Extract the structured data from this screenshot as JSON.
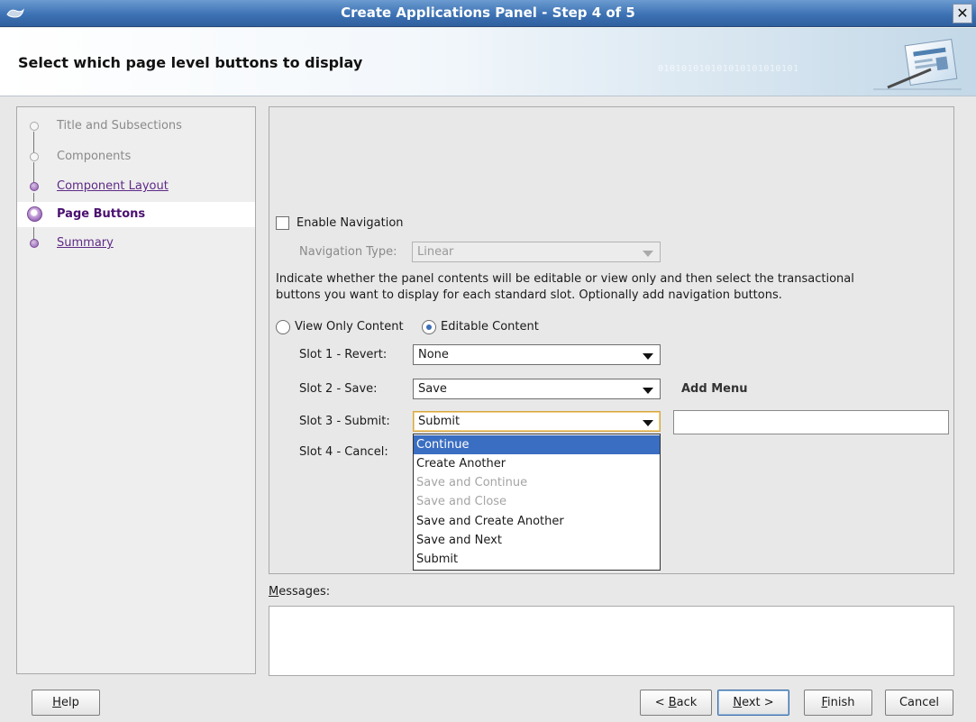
{
  "window": {
    "title": "Create Applications Panel - Step 4 of 5",
    "close_glyph": "✕"
  },
  "header": {
    "heading": "Select which page level buttons to display",
    "decoration_text": "010101010101010101010101"
  },
  "steps": [
    {
      "label": "Title and Subsections",
      "state": "completed"
    },
    {
      "label": "Components",
      "state": "completed"
    },
    {
      "label": "Component Layout",
      "state": "link"
    },
    {
      "label": "Page Buttons",
      "state": "current"
    },
    {
      "label": "Summary",
      "state": "link"
    }
  ],
  "form": {
    "enable_navigation_label": "Enable Navigation",
    "enable_navigation_checked": false,
    "navigation_type_label": "Navigation Type:",
    "navigation_type_value": "Linear",
    "instructions_line1": "Indicate whether the panel contents will be editable or view only and then select the transactional",
    "instructions_line2": "buttons you want to display for each standard slot. Optionally add navigation buttons.",
    "view_only_label": "View Only Content",
    "editable_label": "Editable Content",
    "content_mode": "editable",
    "slot1_label": "Slot 1 - Revert:",
    "slot1_value": "None",
    "slot2_label": "Slot 2 - Save:",
    "slot2_value": "Save",
    "add_menu_label": "Add Menu",
    "slot3_label": "Slot 3 - Submit:",
    "slot3_value": "Submit",
    "slot3_menu_value": "",
    "slot4_label": "Slot 4 - Cancel:"
  },
  "dropdown": {
    "options": [
      {
        "label": "Continue",
        "state": "selected"
      },
      {
        "label": "Create Another",
        "state": "enabled"
      },
      {
        "label": "Save and Continue",
        "state": "disabled"
      },
      {
        "label": "Save and Close",
        "state": "disabled"
      },
      {
        "label": "Save and Create Another",
        "state": "enabled"
      },
      {
        "label": "Save and Next",
        "state": "enabled"
      },
      {
        "label": "Submit",
        "state": "enabled"
      }
    ]
  },
  "messages": {
    "label": "Messages:",
    "content": ""
  },
  "buttons": {
    "help": "Help",
    "back": "< Back",
    "next": "Next >",
    "finish": "Finish",
    "cancel": "Cancel"
  },
  "colors": {
    "title_bar": "#3d72b4",
    "link_purple": "#5e2a86",
    "selection_blue": "#3a6ec2"
  }
}
